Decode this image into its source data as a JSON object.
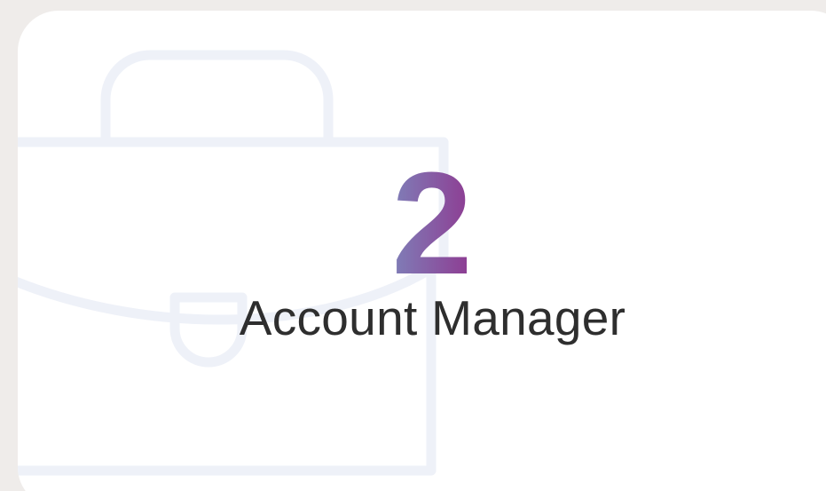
{
  "stat_card": {
    "number": "2",
    "label": "Account Manager",
    "icon": "briefcase-icon"
  },
  "colors": {
    "page_background": "#efecea",
    "card_background": "#ffffff",
    "icon_outline": "#eef1f8",
    "number_gradient_start": "#7f7fb8",
    "number_gradient_end": "#8e3a91",
    "label_text": "#2e2e2e"
  }
}
